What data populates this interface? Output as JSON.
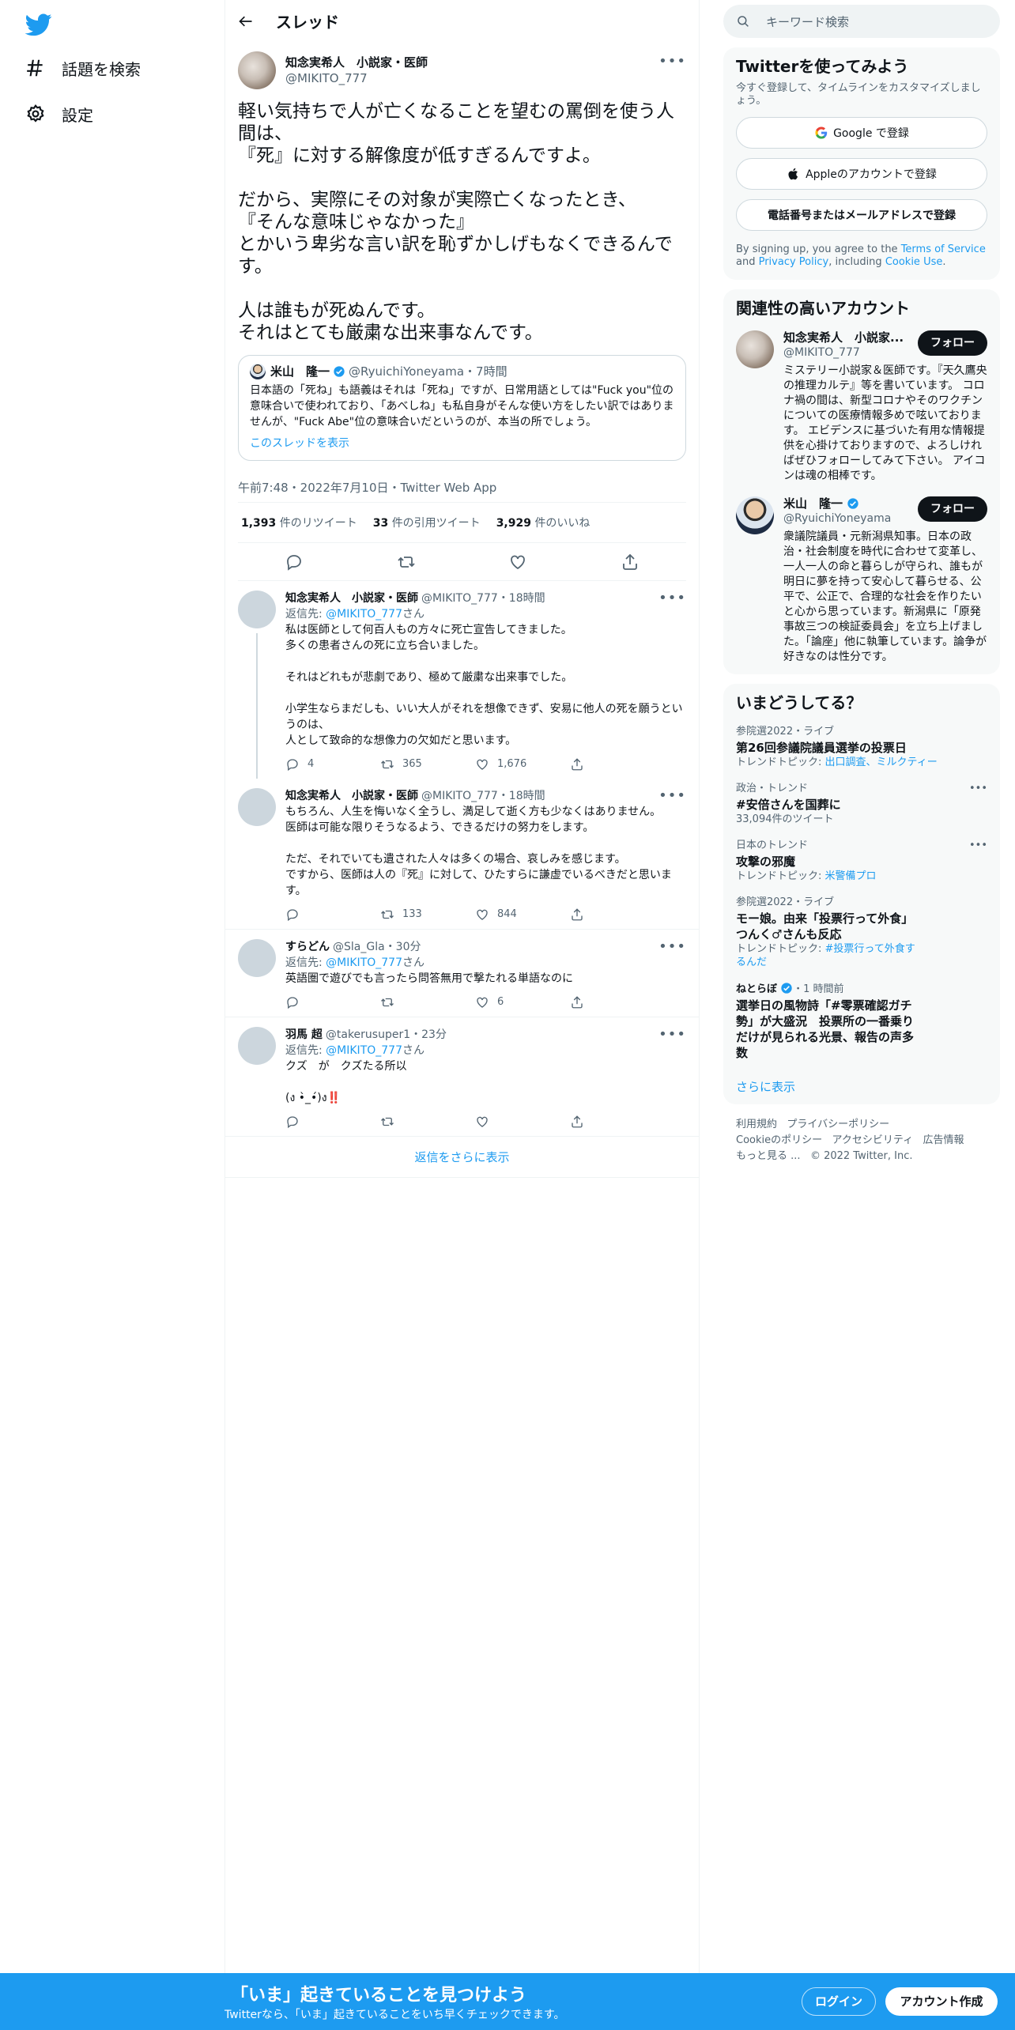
{
  "nav": {
    "explore_label": "話題を検索",
    "settings_label": "設定"
  },
  "thread": {
    "title": "スレッド"
  },
  "main_tweet": {
    "author_name": "知念実希人　小説家・医師",
    "author_handle": "@MIKITO_777",
    "text": "軽い気持ちで人が亡くなることを望むの罵倒を使う人間は、\n『死』に対する解像度が低すぎるんですよ。\n\nだから、実際にその対象が実際亡くなったとき、\n『そんな意味じゃなかった』\nとかいう卑劣な言い訳を恥ずかしげもなくできるんです。\n\n人は誰もが死ぬんです。\nそれはとても厳粛な出来事なんです。",
    "quote": {
      "author_name": "米山　隆一",
      "author_handle": "@RyuichiYoneyama",
      "time": "・7時間",
      "text": "日本語の「死ね」も語義はそれは「死ね」ですが、日常用語としては\"Fuck you\"位の意味合いで使われており、「あべしね」も私自身がそんな使い方をしたい訳ではありませんが、\"Fuck Abe\"位の意味合いだというのが、本当の所でしょう。",
      "link": "このスレッドを表示"
    },
    "timestamp": "午前7:48・2022年7月10日・Twitter Web App",
    "retweets": "1,393",
    "retweets_label": "件のリツイート",
    "quotes": "33",
    "quotes_label": "件の引用ツイート",
    "likes": "3,929",
    "likes_label": "件のいいね"
  },
  "replies": [
    {
      "name": "知念実希人　小説家・医師",
      "handle": "@MIKITO_777",
      "time": "・18時間",
      "reply_to_prefix": "返信先: ",
      "reply_to": "@MIKITO_777",
      "reply_to_suffix": "さん",
      "text": "私は医師として何百人もの方々に死亡宣告してきました。\n多くの患者さんの死に立ち合いました。\n\nそれはどれもが悲劇であり、極めて厳粛な出来事でした。\n\n小学生ならまだしも、いい大人がそれを想像できず、安易に他人の死を願うというのは、\n人として致命的な想像力の欠如だと思います。",
      "replies": "4",
      "retweets": "365",
      "likes": "1,676"
    },
    {
      "name": "知念実希人　小説家・医師",
      "handle": "@MIKITO_777",
      "time": "・18時間",
      "text": "もちろん、人生を悔いなく全うし、満足して逝く方も少なくはありません。\n医師は可能な限りそうなるよう、できるだけの努力をします。\n\nただ、それでいても遺された人々は多くの場合、哀しみを感じます。\nですから、医師は人の『死』に対して、ひたすらに謙虚でいるべきだと思います。",
      "replies": "",
      "retweets": "133",
      "likes": "844"
    },
    {
      "name": "すらどん",
      "handle": "@Sla_Gla",
      "time": "・30分",
      "reply_to_prefix": "返信先: ",
      "reply_to": "@MIKITO_777",
      "reply_to_suffix": "さん",
      "text": "英語圏で遊びでも言ったら問答無用で撃たれる単語なのに",
      "replies": "",
      "retweets": "",
      "likes": "6"
    },
    {
      "name": "羽馬 超",
      "handle": "@takerusuper1",
      "time": "・23分",
      "reply_to_prefix": "返信先: ",
      "reply_to": "@MIKITO_777",
      "reply_to_suffix": "さん",
      "text": "クズ　が　クズたる所以\n\n(ง •̀_•́)ง‼️",
      "replies": "",
      "retweets": "",
      "likes": ""
    }
  ],
  "show_more_replies": "返信をさらに表示",
  "search": {
    "placeholder": "キーワード検索"
  },
  "signup": {
    "title": "Twitterを使ってみよう",
    "subtitle": "今すぐ登録して、タイムラインをカスタマイズしましょう。",
    "google": "Google で登録",
    "apple": "Appleのアカウントで登録",
    "phone": "電話番号またはメールアドレスで登録",
    "legal_prefix": "By signing up, you agree to the ",
    "terms": "Terms of Service",
    "and": " and ",
    "privacy": "Privacy Policy",
    "including": ", including ",
    "cookie": "Cookie Use",
    "period": "."
  },
  "who_to_follow": {
    "title": "関連性の高いアカウント",
    "follow_label": "フォロー",
    "accounts": [
      {
        "name": "知念実希人　小説家...",
        "handle": "@MIKITO_777",
        "bio": "ミステリー小説家＆医師です。『天久鷹央の推理カルテ』等を書いています。 コロナ禍の間は、新型コロナやそのワクチンについての医療情報多めで呟いております。 エビデンスに基づいた有用な情報提供を心掛けておりますので、よろしければぜひフォローしてみて下さい。 アイコンは魂の相棒です。"
      },
      {
        "name": "米山　隆一",
        "handle": "@RyuichiYoneyama",
        "bio": "衆議院議員・元新潟県知事。日本の政治・社会制度を時代に合わせて変革し、一人一人の命と暮らしが守られ、誰もが明日に夢を持って安心して暮らせる、公平で、公正で、合理的な社会を作りたいと心から思っています。新潟県に「原発事故三つの検証委員会」を立ち上げました。「論座」他に執筆しています。論争が好きなのは性分です。"
      }
    ]
  },
  "trends": {
    "title": "いまどうしてる？",
    "items": [
      {
        "context": "参院選2022・ライブ",
        "title": "第26回参議院議員選挙の投票日",
        "sub_prefix": "トレンドトピック: ",
        "sub_link": "出口調査、ミルクティー"
      },
      {
        "context": "政治・トレンド",
        "title": "#安倍さんを国葬に",
        "sub": "33,094件のツイート"
      },
      {
        "context": "日本のトレンド",
        "title": "攻撃の邪魔",
        "sub_prefix": "トレンドトピック: ",
        "sub_link": "米警備プロ"
      },
      {
        "context": "参院選2022・ライブ",
        "title": "モー娘。由来「投票行って外食」つんく♂さんも反応",
        "sub_prefix": "トレンドトピック: ",
        "sub_link": "#投票行って外食するんだ"
      },
      {
        "context_user": "ねとらぼ",
        "context_time": "・1 時間前",
        "title": "選挙日の風物詩「#零票確認ガチ勢」が大盛況　投票所の一番乗りだけが見られる光景、報告の声多数"
      }
    ],
    "show_more": "さらに表示"
  },
  "footer": {
    "terms": "利用規約",
    "privacy": "プライバシーポリシー",
    "cookie": "Cookieのポリシー",
    "accessibility": "アクセシビリティ",
    "ads": "広告情報",
    "more": "もっと見る ...",
    "copyright": "© 2022 Twitter, Inc."
  },
  "banner": {
    "title": "「いま」起きていることを見つけよう",
    "subtitle": "Twitterなら、「いま」起きていることをいち早くチェックできます。",
    "login": "ログイン",
    "signup": "アカウント作成"
  },
  "colors": {
    "accent": "#1d9bf0",
    "text": "#0f1419",
    "muted": "#536471"
  }
}
